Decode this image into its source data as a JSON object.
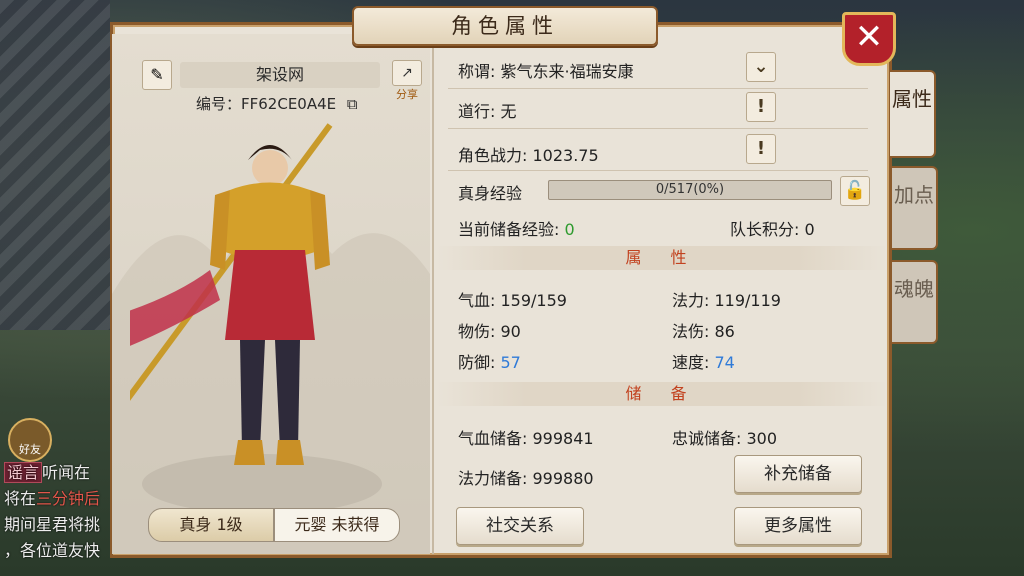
{
  "window": {
    "title": "角色属性",
    "close_icon": "close-icon"
  },
  "side_tabs": [
    {
      "label": "属性",
      "active": true
    },
    {
      "label": "加点",
      "active": false
    },
    {
      "label": "魂魄",
      "active": false
    }
  ],
  "character": {
    "name": "架设网",
    "id_label": "编号：FF62CE0A4E",
    "share_label": "分享",
    "tab_body": "真身 1级",
    "tab_yuanying": "元婴 未获得"
  },
  "info": {
    "title_label": "称谓:",
    "title_value": "紫气东来·福瑞安康",
    "daoxing_label": "道行:",
    "daoxing_value": "无",
    "power_label": "角色战力:",
    "power_value": "1023.75",
    "xp_label": "真身经验",
    "xp_text": "0/517(0%)",
    "xp_progress": 0,
    "stored_xp_label": "当前储备经验:",
    "stored_xp_value": "0",
    "captain_label": "队长积分:",
    "captain_value": "0"
  },
  "attributes": {
    "section_label": "属 性",
    "hp_label": "气血:",
    "hp_value": "159/159",
    "mp_label": "法力:",
    "mp_value": "119/119",
    "phys_label": "物伤:",
    "phys_value": "90",
    "magic_label": "法伤:",
    "magic_value": "86",
    "def_label": "防御:",
    "def_value": "57",
    "speed_label": "速度:",
    "speed_value": "74"
  },
  "reserves": {
    "section_label": "储 备",
    "hp_res_label": "气血储备:",
    "hp_res_value": "999841",
    "loyal_label": "忠诚储备:",
    "loyal_value": "300",
    "mp_res_label": "法力储备:",
    "mp_res_value": "999880"
  },
  "buttons": {
    "refill": "补充储备",
    "social": "社交关系",
    "more": "更多属性"
  },
  "background": {
    "friend_label": "好友",
    "chat_tag": "谣言",
    "chat_line1": "听闻在",
    "chat_line2a": "将在",
    "chat_line2b": "三分钟后",
    "chat_line3": "期间星君将挑",
    "chat_line4": "，各位道友快"
  },
  "colors": {
    "accent": "#8b5a2b",
    "close": "#b3212a",
    "green_value": "#2e9a2e",
    "blue_value": "#2e7ad8",
    "section_title": "#c2421f"
  }
}
